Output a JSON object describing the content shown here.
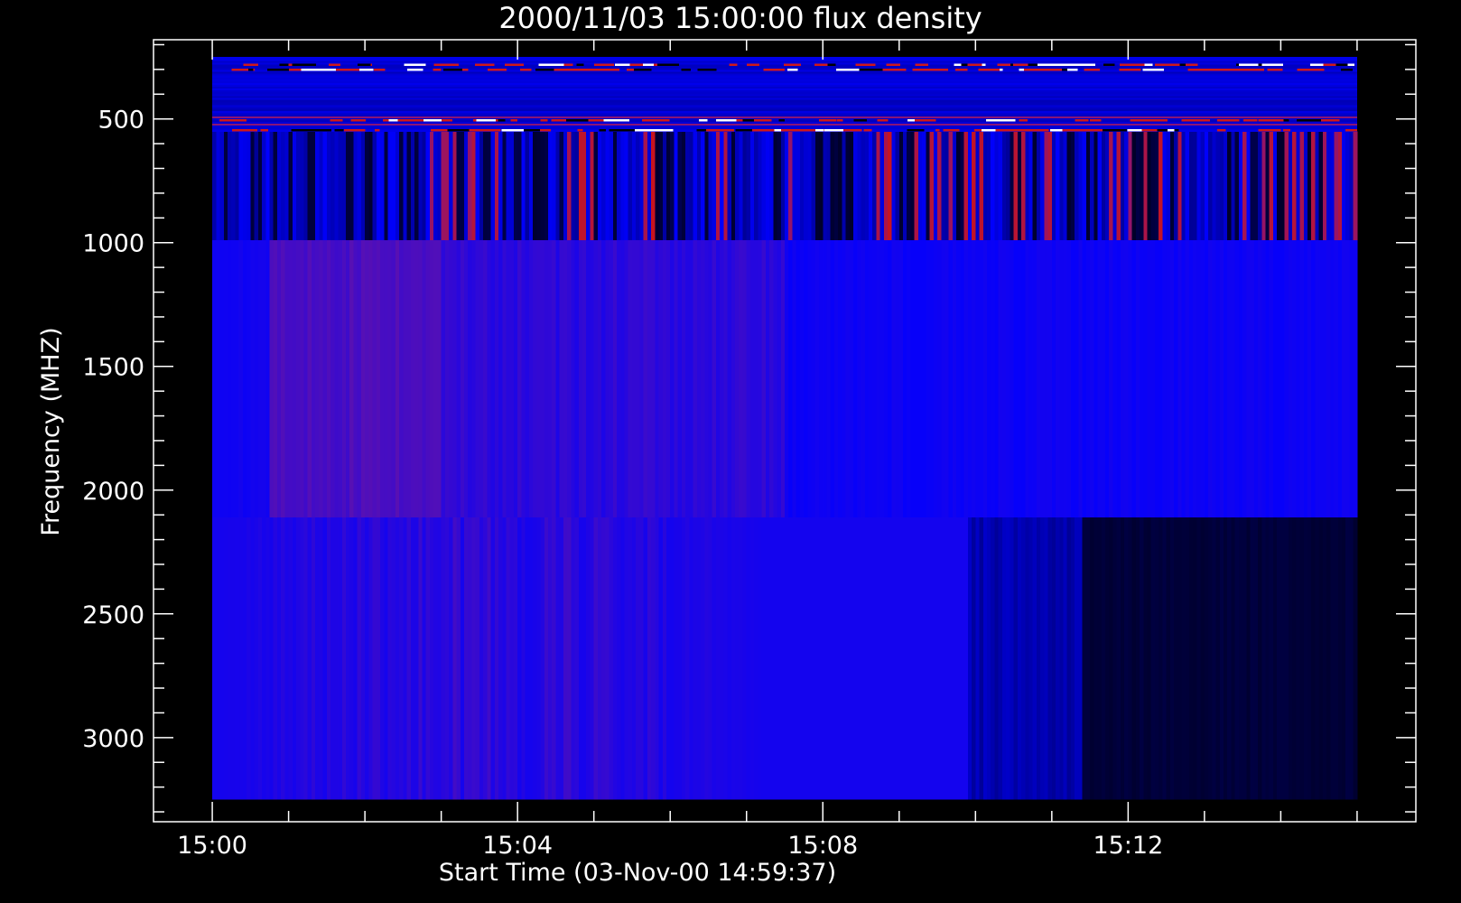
{
  "chart_data": {
    "type": "heatmap",
    "title": "2000/11/03 15:00:00 flux density",
    "xlabel": "Start Time (03-Nov-00 14:59:37)",
    "ylabel": "Frequency (MHZ)",
    "x_ticks": [
      {
        "label": "15:00",
        "minutes": 0
      },
      {
        "label": "15:04",
        "minutes": 4
      },
      {
        "label": "15:08",
        "minutes": 8
      },
      {
        "label": "15:12",
        "minutes": 12
      }
    ],
    "y_ticks": [
      {
        "label": "500",
        "value": 500
      },
      {
        "label": "1000",
        "value": 1000
      },
      {
        "label": "1500",
        "value": 1500
      },
      {
        "label": "2000",
        "value": 2000
      },
      {
        "label": "2500",
        "value": 2500
      },
      {
        "label": "3000",
        "value": 3000
      }
    ],
    "x_range_minutes": [
      -0.77,
      15.77
    ],
    "y_range_mhz": [
      180,
      3340
    ],
    "y_inverted": true,
    "data_extent": {
      "x_minutes": [
        0,
        15
      ],
      "y_mhz": [
        250,
        3250
      ]
    },
    "bands": [
      {
        "name": "band-low",
        "y_mhz": [
          250,
          550
        ],
        "texture": "horizontal"
      },
      {
        "name": "band-mid",
        "y_mhz": [
          550,
          990
        ],
        "texture": "vertical-strong"
      },
      {
        "name": "band-high",
        "y_mhz": [
          990,
          2110
        ],
        "texture": "vertical-smooth"
      },
      {
        "name": "band-top",
        "y_mhz": [
          2110,
          3250
        ],
        "texture": "vertical-smooth"
      }
    ],
    "colormap": [
      "#000000",
      "#00004a",
      "#0000ff",
      "#7a1090",
      "#cc1010",
      "#ffffff"
    ],
    "colors": {
      "background": "#000000",
      "axes": "#ffffff",
      "text": "#ffffff"
    }
  }
}
